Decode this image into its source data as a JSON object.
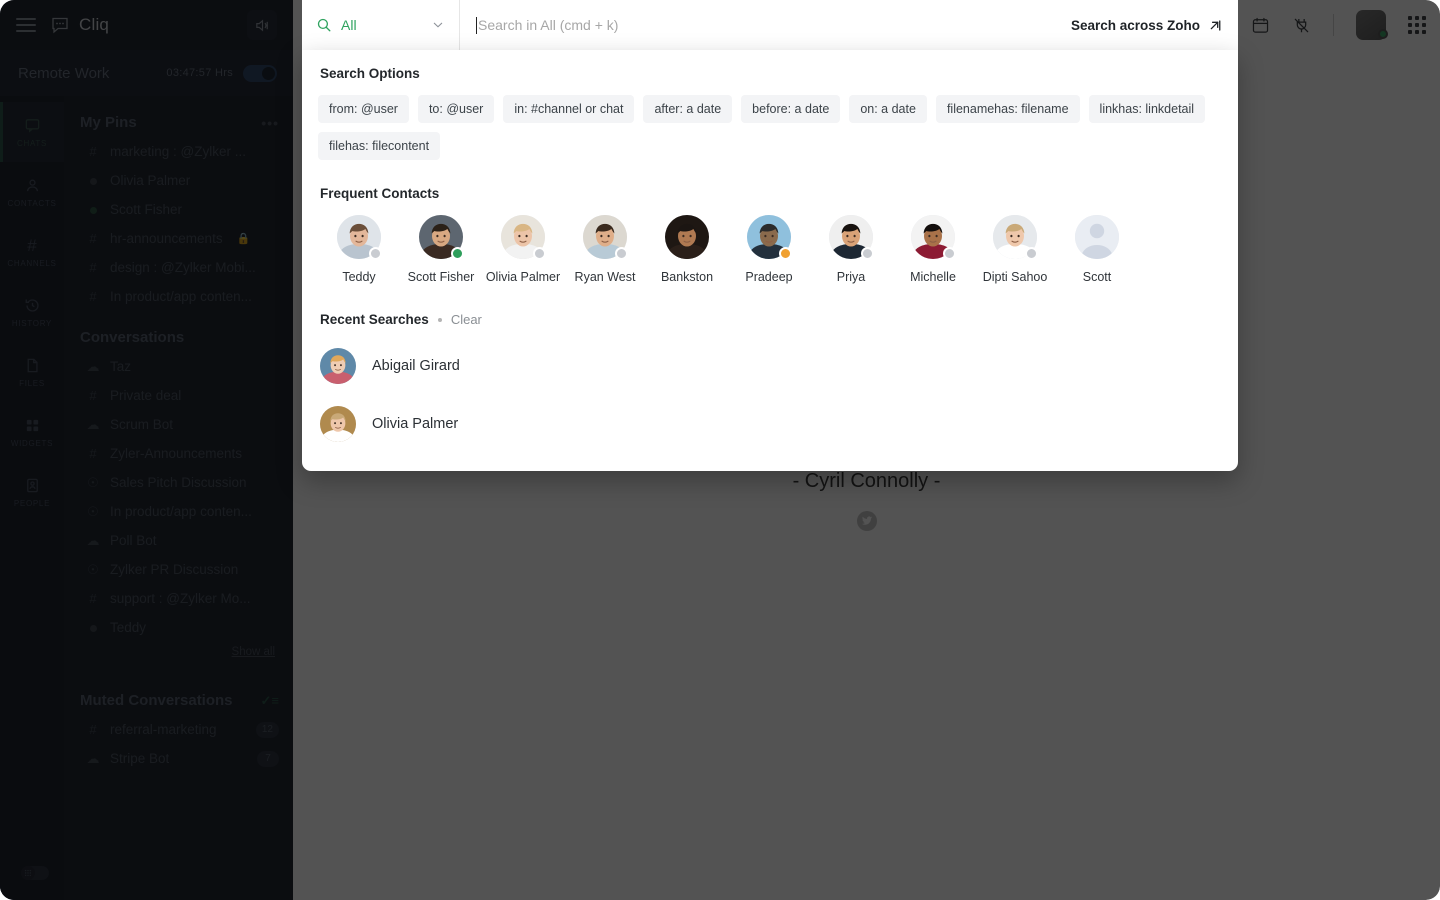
{
  "window": {
    "app_name": "Cliq",
    "logo_icon": "chat-bubble-icon",
    "menu_icon": "hamburger-menu-icon",
    "speaker_icon": "speaker-volume-icon"
  },
  "status_bar": {
    "title": "Remote Work",
    "time": "03:47:57 Hrs",
    "toggle_state": "on"
  },
  "nav_rail": {
    "items": [
      {
        "label": "CHATS",
        "icon": "chat-icon",
        "active": true
      },
      {
        "label": "CONTACTS",
        "icon": "person-icon",
        "active": false
      },
      {
        "label": "CHANNELS",
        "icon": "hash-icon",
        "active": false
      },
      {
        "label": "HISTORY",
        "icon": "history-clock-icon",
        "active": false
      },
      {
        "label": "FILES",
        "icon": "file-icon",
        "active": false
      },
      {
        "label": "WIDGETS",
        "icon": "grid-squares-icon",
        "active": false
      },
      {
        "label": "PEOPLE",
        "icon": "contact-card-icon",
        "active": false
      }
    ],
    "theme_toggle_icon": "sun-theme-toggle-icon"
  },
  "sidebar": {
    "pins": {
      "title": "My Pins",
      "more_icon": "ellipsis-icon",
      "items": [
        {
          "icon": "hash",
          "label": "marketing : @Zylker ...",
          "locked": false
        },
        {
          "icon": "dot",
          "label": "Olivia Palmer",
          "locked": false
        },
        {
          "icon": "dot-green",
          "label": "Scott Fisher",
          "locked": false
        },
        {
          "icon": "hash",
          "label": "hr-announcements",
          "locked": true
        },
        {
          "icon": "hash",
          "label": "design : @Zylker Mobi...",
          "locked": false
        },
        {
          "icon": "hash",
          "label": "In product/app conten...",
          "locked": false
        }
      ]
    },
    "conversations": {
      "title": "Conversations",
      "show_all_label": "Show all",
      "items": [
        {
          "icon": "bot",
          "label": "Taz"
        },
        {
          "icon": "hash",
          "label": "Private deal"
        },
        {
          "icon": "bot",
          "label": "Scrum Bot"
        },
        {
          "icon": "hash",
          "label": "Zyler-Announcements"
        },
        {
          "icon": "group",
          "label": "Sales Pitch Discussion"
        },
        {
          "icon": "group",
          "label": "In product/app conten..."
        },
        {
          "icon": "bot",
          "label": "Poll Bot"
        },
        {
          "icon": "group",
          "label": "Zylker PR Discussion"
        },
        {
          "icon": "hash",
          "label": "support : @Zylker Mo..."
        },
        {
          "icon": "dot",
          "label": "Teddy"
        }
      ]
    },
    "muted": {
      "title": "Muted Conversations",
      "action_icon": "mark-all-read-icon",
      "items": [
        {
          "icon": "hash",
          "label": "referral-marketing",
          "badge": "12"
        },
        {
          "icon": "bot",
          "label": "Stripe Bot",
          "badge": "7"
        }
      ]
    }
  },
  "top_right": {
    "calendar_icon": "calendar-icon",
    "integrations_icon": "plug-icon",
    "avatar_icon": "user-avatar",
    "presence": "online",
    "apps_icon": "apps-grid-icon"
  },
  "main": {
    "quote_author": "- Cyril Connolly -",
    "share_icon": "twitter-icon"
  },
  "search": {
    "scope_label": "All",
    "scope_icon": "search-icon",
    "chevron_icon": "chevron-down-icon",
    "placeholder": "Search in All (cmd + k)",
    "value": "",
    "zoho_link_label": "Search across Zoho",
    "zoho_link_icon": "external-link-arrow-icon",
    "options": {
      "title": "Search Options",
      "chips": [
        "from: @user",
        "to: @user",
        "in: #channel or chat",
        "after: a date",
        "before: a date",
        "on: a date",
        "filenamehas: filename",
        "linkhas: linkdetail",
        "filehas: filecontent"
      ]
    },
    "frequent_contacts": {
      "title": "Frequent Contacts",
      "items": [
        {
          "name": "Teddy",
          "presence": "offline",
          "hair": "#6b4f3a",
          "skin": "#e3b79a",
          "shirt": "#b9c4cf",
          "bg": "#dfe4e9"
        },
        {
          "name": "Scott Fisher",
          "presence": "online",
          "hair": "#2b2118",
          "skin": "#d8a882",
          "shirt": "#3a2a22",
          "bg": "#5d6670"
        },
        {
          "name": "Olivia Palmer",
          "presence": "offline",
          "hair": "#d9b684",
          "skin": "#ecc4a8",
          "shirt": "#f2f2f2",
          "bg": "#e8e4dc"
        },
        {
          "name": "Ryan West",
          "presence": "offline",
          "hair": "#3a2a1e",
          "skin": "#dfae89",
          "shirt": "#b8cad6",
          "bg": "#dcd8d0"
        },
        {
          "name": "Bankston",
          "presence": "none",
          "hair": "#1b1512",
          "skin": "#b07a52",
          "shirt": "#2a1f19",
          "bg": "#1e1713"
        },
        {
          "name": "Pradeep",
          "presence": "away",
          "hair": "#2b2b2b",
          "skin": "#8a6a4c",
          "shirt": "#23303d",
          "bg": "#8fc0dd"
        },
        {
          "name": "Priya",
          "presence": "offline",
          "hair": "#17120f",
          "skin": "#d9a277",
          "shirt": "#1d2733",
          "bg": "#efefef"
        },
        {
          "name": "Michelle",
          "presence": "offline",
          "hair": "#140f0d",
          "skin": "#a97249",
          "shirt": "#8c1b33",
          "bg": "#f3f3f3"
        },
        {
          "name": "Dipti Sahoo",
          "presence": "offline",
          "hair": "#c9a978",
          "skin": "#efc8ab",
          "shirt": "#ffffff",
          "bg": "#e6e9ec"
        },
        {
          "name": "Scott",
          "presence": "none",
          "hair": "#cfd6e2",
          "skin": "#cfd6e2",
          "shirt": "#cfd6e2",
          "bg": "#e9edf3"
        }
      ]
    },
    "recent_searches": {
      "title": "Recent Searches",
      "clear_label": "Clear",
      "items": [
        {
          "name": "Abigail Girard",
          "hair": "#e0a85c",
          "skin": "#f0cdb4",
          "shirt": "#c95f6e",
          "bg": "#5f89a8"
        },
        {
          "name": "Olivia Palmer",
          "hair": "#c9a978",
          "skin": "#eec7ab",
          "shirt": "#ffffff",
          "bg": "#b08a4e"
        }
      ]
    }
  },
  "colors": {
    "accent_green": "#2fa35f",
    "online": "#2e9e5b",
    "away": "#f0a030",
    "offline": "#c9ccd1",
    "overlay": "rgba(10,10,10,0.70)",
    "sidebar_bg": "#0e1420"
  }
}
